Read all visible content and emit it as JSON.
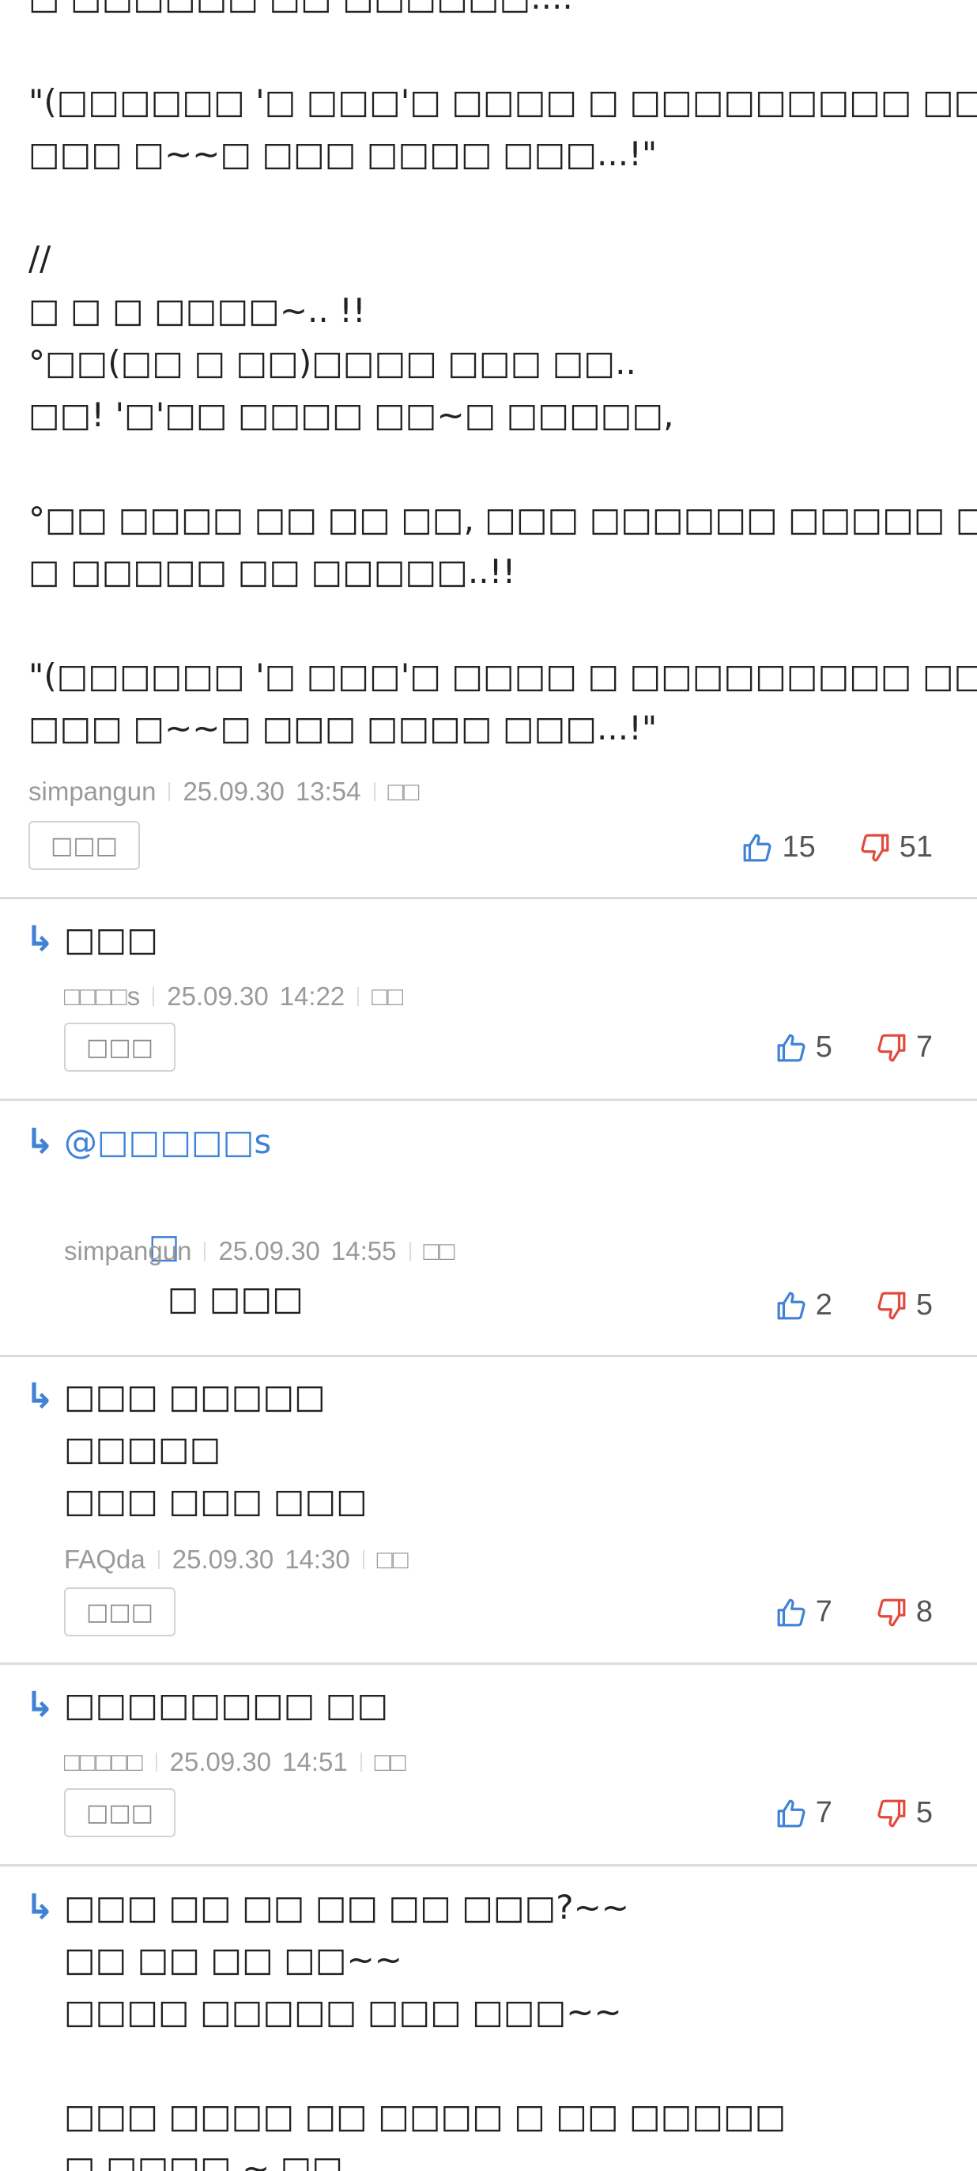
{
  "top_comment": {
    "lines": [
      "□ □□□□□□ □□ □□□□□□....",
      "",
      "\"(□□□□□□ '□ □□□'□ □□□□ □ □□□□□□□□□ □□ □ □□)",
      "□□□ □~~□ □□□ □□□□ □□□...!\"",
      "",
      "//",
      "□ □ □ □□□□~.. !!",
      "°□□(□□ □ □□)□□□□ □□□ □□..",
      "□□! '□'□□ □□□□ □□~□ □□□□□,",
      "",
      "°□□ □□□□ □□ □□ □□, □□□ □□□□□□ □□□□□ □□ □□",
      "□ □□□□□ □□ □□□□□..!!",
      "",
      "\"(□□□□□□ '□ □□□'□ □□□□ □ □□□□□□□□□ □□ □ □□)",
      "□□□ □~~□ □□□ □□□□ □□□...!\""
    ],
    "author": "simpangun",
    "date": "25.09.30",
    "time": "13:54",
    "report": "□□",
    "reply_label": "□□□",
    "up": "15",
    "down": "51"
  },
  "replies": [
    {
      "arrow": "↳",
      "lines": [
        "□□□"
      ],
      "author": "□□□□s",
      "date": "25.09.30",
      "time": "14:22",
      "report": "□□",
      "reply_label": "□□□",
      "up": "5",
      "down": "7"
    },
    {
      "arrow": "↳",
      "mention": "@□□□□□s",
      "icon": "□",
      "lines": [
        "□ □□□"
      ],
      "author": "simpangun",
      "date": "25.09.30",
      "time": "14:55",
      "report": "□□",
      "up": "2",
      "down": "5"
    },
    {
      "arrow": "↳",
      "lines": [
        "□□□ □□□□□",
        "□□□□□",
        "□□□ □□□ □□□"
      ],
      "author": "FAQda",
      "date": "25.09.30",
      "time": "14:30",
      "report": "□□",
      "reply_label": "□□□",
      "up": "7",
      "down": "8"
    },
    {
      "arrow": "↳",
      "lines": [
        "□□□□□□□□ □□"
      ],
      "author": "□□□□□",
      "date": "25.09.30",
      "time": "14:51",
      "report": "□□",
      "reply_label": "□□□",
      "up": "7",
      "down": "5"
    },
    {
      "arrow": "↳",
      "lines": [
        "□□□ □□ □□ □□ □□ □□□?~~",
        "□□ □□ □□ □□~~",
        "□□□□ □□□□□ □□□ □□□~~",
        "",
        "□□□ □□□□ □□ □□□□ □ □□ □□□□□",
        "□ □□□□ ~ □□"
      ]
    }
  ],
  "colors": {
    "accent": "#3f82d6",
    "downvote": "#e2493b",
    "meta": "#9a9a9a",
    "divider": "#dcdcdc"
  }
}
